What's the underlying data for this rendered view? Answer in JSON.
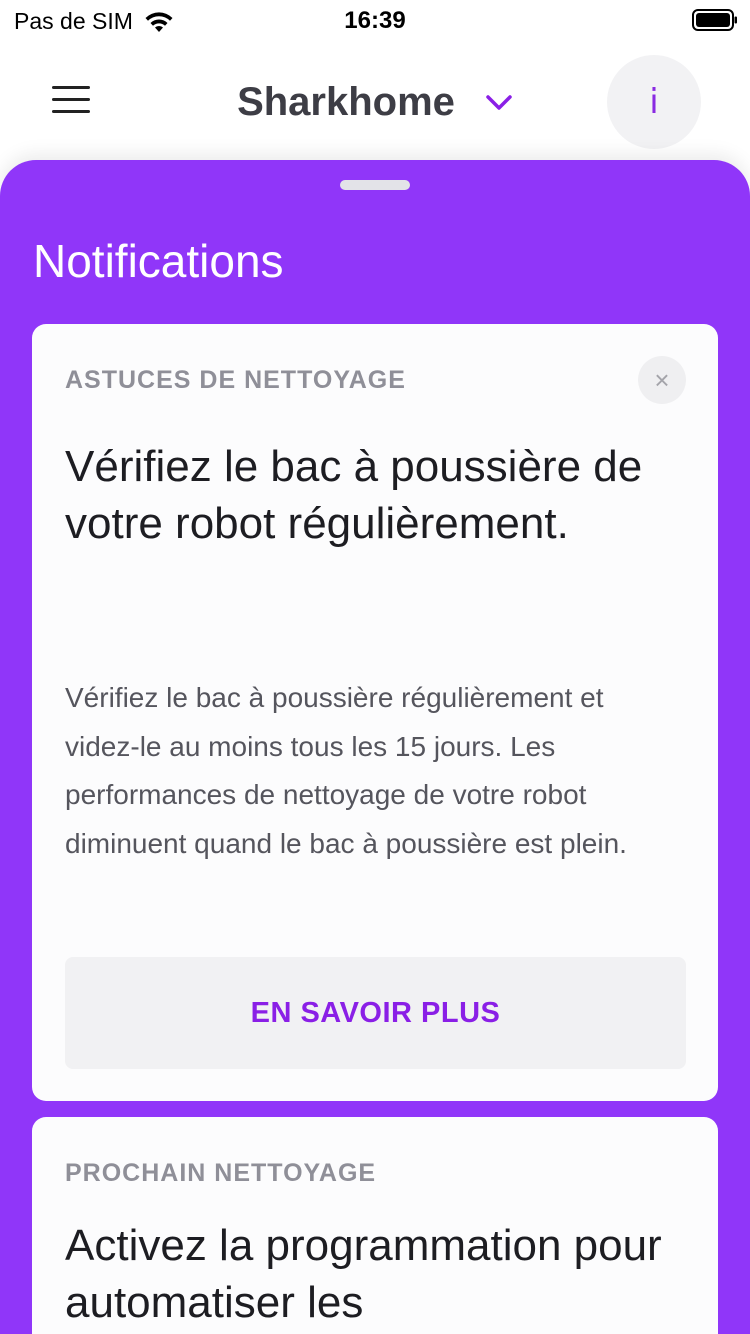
{
  "status_bar": {
    "carrier": "Pas de SIM",
    "time": "16:39"
  },
  "header": {
    "home_name": "Sharkhome",
    "info_label": "i"
  },
  "sheet": {
    "title": "Notifications"
  },
  "notifications": [
    {
      "category": "ASTUCES DE NETTOYAGE",
      "headline": "Vérifiez le bac à poussière de votre robot régulièrement.",
      "body": "Vérifiez le bac à poussière régulièrement et videz-le au moins tous les 15 jours. Les performances de nettoyage de votre robot diminuent quand le bac à poussière est plein.",
      "cta_label": "EN SAVOIR PLUS",
      "close_label": "×"
    },
    {
      "category": "PROCHAIN NETTOYAGE",
      "headline": "Activez la programmation pour automatiser les"
    }
  ],
  "colors": {
    "accent": "#9036f9",
    "cta_text": "#8a1fe6"
  }
}
